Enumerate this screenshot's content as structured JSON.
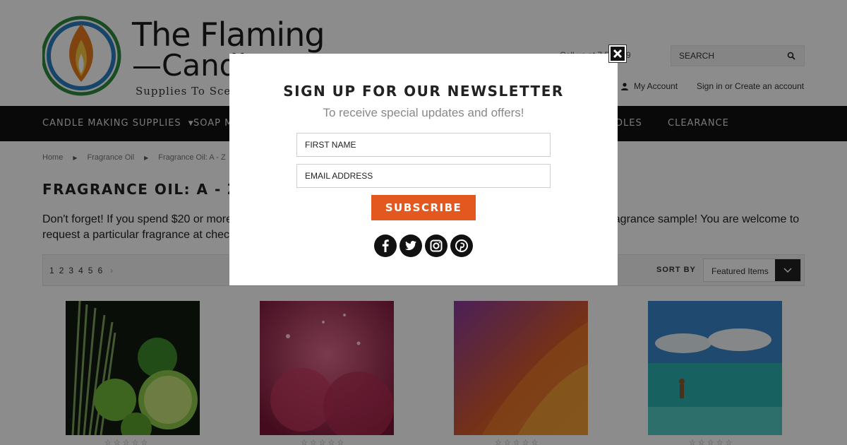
{
  "header": {
    "logo_line1": "The Flaming",
    "logo_line2": "—Candle",
    "logo_tagline": "Supplies To Scent",
    "phone": "Call us at 7 5-4999",
    "search_placeholder": "SEARCH",
    "my_account": "My Account",
    "sign_in": "Sign in or Create an account"
  },
  "nav": {
    "items": [
      {
        "label": "CANDLE MAKING SUPPLIES",
        "has_dropdown": true
      },
      {
        "label": "SOAP M",
        "has_dropdown": false
      },
      {
        "label": "DLES",
        "has_dropdown": false
      },
      {
        "label": "CLEARANCE",
        "has_dropdown": false
      }
    ]
  },
  "breadcrumb": [
    "Home",
    "Fragrance Oil",
    "Fragrance Oil: A - Z"
  ],
  "page_title": "FRAGRANCE OIL: A - Z",
  "promo": {
    "line1_left": "Don't forget! If you spend $20 or more",
    "line1_right": "fragrance sample! You are welcome to",
    "line2_left": "request a particular fragrance at check"
  },
  "toolbar": {
    "pages": [
      "1",
      "2",
      "3",
      "4",
      "5",
      "6"
    ],
    "next_icon": "chevron-right-icon",
    "sort_label": "SORT BY",
    "sort_value": "Featured Items"
  },
  "products": [
    {
      "image": "lime-lemongrass",
      "rating": 0
    },
    {
      "image": "pink-sparkle-flower",
      "rating": 0
    },
    {
      "image": "orange-petal-droplets",
      "rating": 0
    },
    {
      "image": "tropical-ocean",
      "rating": 0
    }
  ],
  "modal": {
    "title": "SIGN UP FOR OUR NEWSLETTER",
    "subtitle": "To receive special updates and offers!",
    "first_name_placeholder": "FIRST NAME",
    "email_placeholder": "EMAIL ADDRESS",
    "subscribe_label": "SUBSCRIBE",
    "socials": [
      "facebook-icon",
      "twitter-icon",
      "instagram-icon",
      "pinterest-icon"
    ],
    "close_icon": "close-icon"
  },
  "colors": {
    "accent": "#e2581f",
    "nav_bg": "#111111",
    "overlay": "rgba(0,0,0,0.45)"
  }
}
